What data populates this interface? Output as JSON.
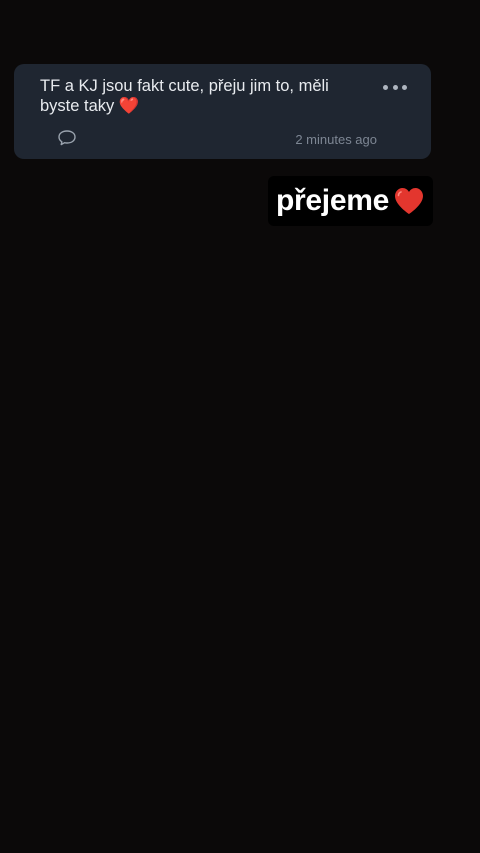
{
  "post": {
    "text": "TF a KJ jsou fakt cute, přeju jim to, měli byste taky",
    "emoji": "❤️",
    "timestamp": "2 minutes ago",
    "more_icon": "more-horizontal-icon",
    "comment_icon": "comment-bubble-icon"
  },
  "sticker": {
    "text": "přejeme",
    "emoji": "❤️"
  },
  "colors": {
    "background": "#0b0909",
    "card": "#1f2631",
    "heart": "#e23b3b"
  }
}
